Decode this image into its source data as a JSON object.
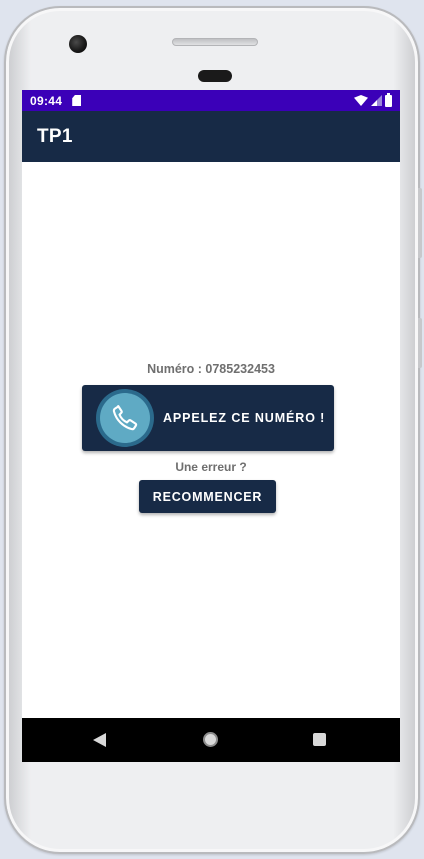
{
  "status_bar": {
    "time": "09:44",
    "background": "#3b00b8"
  },
  "app_bar": {
    "title": "TP1",
    "background": "#172a46"
  },
  "main": {
    "number_label": "Numéro : 0785232453",
    "call_button_label": "APPELEZ CE NUMÉRO !",
    "call_icon": "phone-handset-icon",
    "error_prompt": "Une erreur ?",
    "restart_button_label": "RECOMMENCER",
    "accent_color": "#172a46",
    "icon_color": "#5faac4"
  },
  "nav_bar": {
    "icons": [
      "back-triangle-icon",
      "home-circle-icon",
      "recent-square-icon"
    ]
  }
}
